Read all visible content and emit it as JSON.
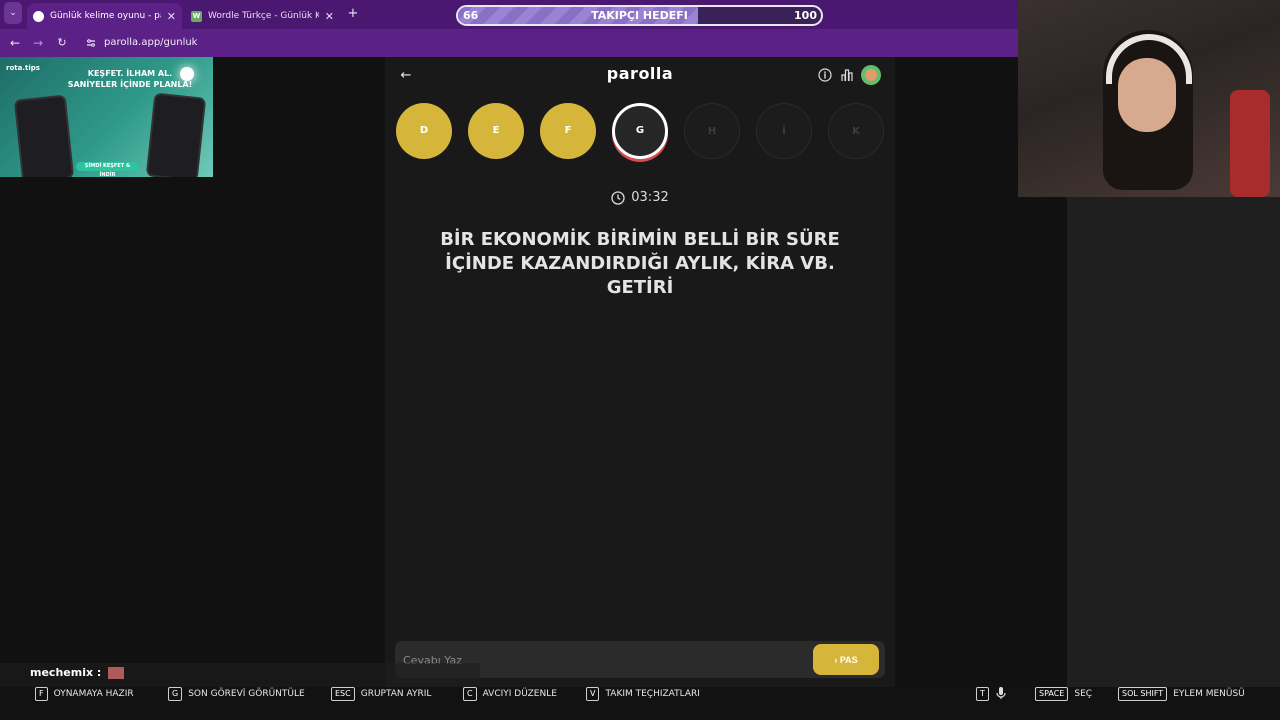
{
  "browser": {
    "tabs": [
      {
        "title": "Günlük kelime oyunu - parolla",
        "active": true,
        "favicon_color": "#ffffff"
      },
      {
        "title": "Wordle Türkçe - Günlük Kelime",
        "active": false,
        "favicon_color": "#6aaa64",
        "favicon_letter": "W"
      }
    ],
    "url": "parolla.app/gunluk"
  },
  "goal": {
    "current": "66",
    "label": "TAKIPÇI HEDEFI",
    "target": "100",
    "progress_fraction": 0.66
  },
  "ad": {
    "brand": "rota.tips",
    "headline_line1": "KEŞFET. İLHAM AL.",
    "headline_line2": "SANİYELER İÇİNDE PLANLA!",
    "cta": "ŞİMDİ KEŞFET & İNDİR"
  },
  "game": {
    "logo": "parolla",
    "letters": [
      {
        "letter": "D",
        "state": "done"
      },
      {
        "letter": "E",
        "state": "done"
      },
      {
        "letter": "F",
        "state": "done"
      },
      {
        "letter": "G",
        "state": "current"
      },
      {
        "letter": "H",
        "state": "todo"
      },
      {
        "letter": "İ",
        "state": "todo"
      },
      {
        "letter": "K",
        "state": "todo"
      }
    ],
    "timer": "03:32",
    "question": "BİR EKONOMİK BİRİMİN BELLİ BİR SÜRE İÇİNDE KAZANDIRDIĞI AYLIK, KİRA VB. GETİRİ",
    "input_placeholder": "Cevabı Yaz",
    "pass_label": "PAS"
  },
  "overlay": {
    "chat_user": "mechemix :",
    "keys": [
      {
        "key": "F",
        "label": "OYNAMAYA HAZIR"
      },
      {
        "key": "G",
        "label": "SON GÖREVİ GÖRÜNTÜLE"
      },
      {
        "key": "ESC",
        "label": "GRUPTAN AYRIL"
      },
      {
        "key": "C",
        "label": "AVCIYI DÜZENLE"
      },
      {
        "key": "V",
        "label": "TAKIM TEÇHIZATLARI"
      },
      {
        "key": "T",
        "label": ""
      },
      {
        "key": "SPACE",
        "label": "SEÇ"
      },
      {
        "key": "SOL SHIFT",
        "label": "EYLEM MENÜSÜ"
      }
    ]
  },
  "colors": {
    "browser_purple": "#5b2186",
    "accent_yellow": "#d6b63a",
    "panel_bg": "#191919"
  }
}
